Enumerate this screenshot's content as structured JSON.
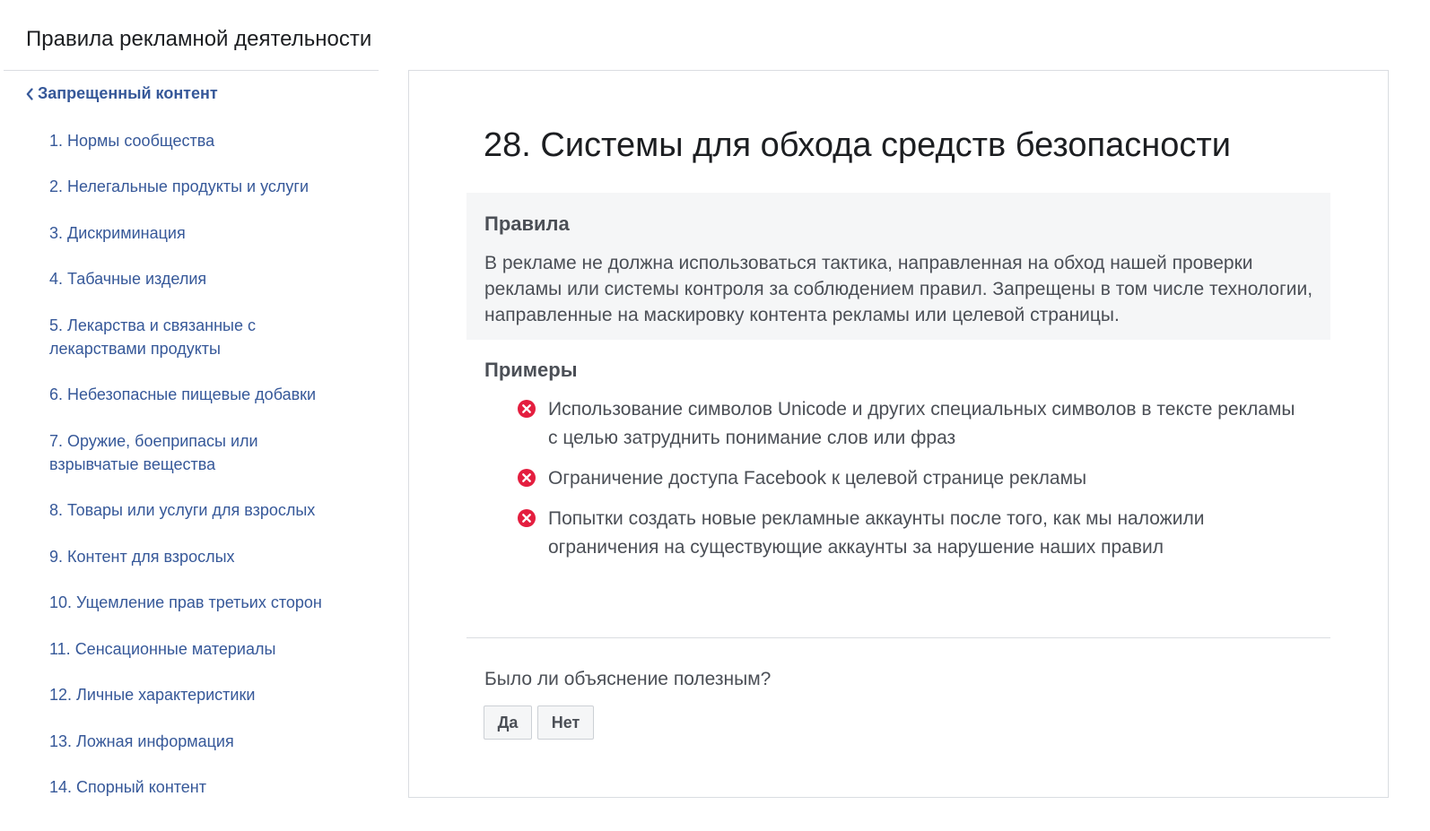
{
  "header": {
    "title": "Правила рекламной деятельности"
  },
  "sidebar": {
    "back_label": "Запрещенный контент",
    "items": [
      {
        "label": "1. Нормы сообщества"
      },
      {
        "label": "2. Нелегальные продукты и услуги"
      },
      {
        "label": "3. Дискриминация"
      },
      {
        "label": "4. Табачные изделия"
      },
      {
        "label": "5. Лекарства и связанные с лекарствами продукты"
      },
      {
        "label": "6. Небезопасные пищевые добавки"
      },
      {
        "label": "7. Оружие, боеприпасы или взрывчатые вещества"
      },
      {
        "label": "8. Товары или услуги для взрослых"
      },
      {
        "label": "9. Контент для взрослых"
      },
      {
        "label": "10. Ущемление прав третьих сторон"
      },
      {
        "label": "11. Сенсационные материалы"
      },
      {
        "label": "12. Личные характеристики"
      },
      {
        "label": "13. Ложная информация"
      },
      {
        "label": "14. Спорный контент"
      }
    ]
  },
  "article": {
    "title": "28. Системы для обхода средств безопасности",
    "rules_heading": "Правила",
    "rules_text": "В рекламе не должна использоваться тактика, направленная на обход нашей проверки рекламы или системы контроля за соблюдением правил. Запрещены в том числе технологии, направленные на маскировку контента рекламы или целевой страницы.",
    "examples_heading": "Примеры",
    "examples": [
      {
        "text": "Использование символов Unicode и других специальных символов в тексте рекламы с целью затруднить понимание слов или фраз"
      },
      {
        "text": "Ограничение доступа Facebook к целевой странице рекламы"
      },
      {
        "text": "Попытки создать новые рекламные аккаунты после того, как мы наложили ограничения на существующие аккаунты за нарушение наших правил"
      }
    ]
  },
  "feedback": {
    "question": "Было ли объяснение полезным?",
    "yes_label": "Да",
    "no_label": "Нет"
  },
  "colors": {
    "link": "#365899",
    "x_icon": "#e41e3f",
    "rules_bg": "#f5f6f7"
  }
}
